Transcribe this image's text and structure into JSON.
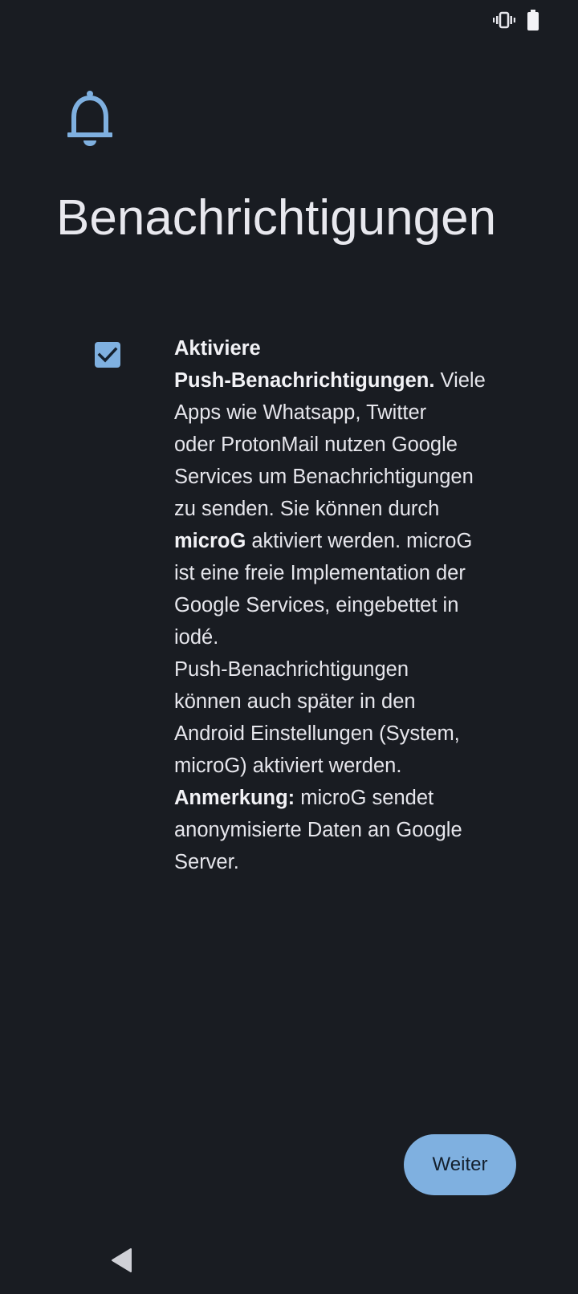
{
  "status_bar": {
    "icons": [
      "vibrate-icon",
      "battery-icon"
    ]
  },
  "header": {
    "icon": "bell-icon",
    "title": "Benachrichtigungen"
  },
  "option": {
    "checked": true,
    "lines": [
      {
        "bold": "Aktiviere",
        "text": ""
      },
      {
        "bold": "Push-Benachrichtigungen.",
        "text": " Viele"
      },
      {
        "bold": "",
        "text": "Apps wie Whatsapp, Twitter"
      },
      {
        "bold": "",
        "text": "oder ProtonMail nutzen Google"
      },
      {
        "bold": "",
        "text": "Services um Benachrichtigungen"
      },
      {
        "bold": "",
        "text": "zu senden. Sie können durch"
      },
      {
        "bold": "microG",
        "text": " aktiviert werden. microG"
      },
      {
        "bold": "",
        "text": "ist eine freie Implementation der"
      },
      {
        "bold": "",
        "text": "Google Services, eingebettet in"
      },
      {
        "bold": "",
        "text": "iodé."
      },
      {
        "bold": "",
        "text": "Push-Benachrichtigungen"
      },
      {
        "bold": "",
        "text": "können auch später in den"
      },
      {
        "bold": "",
        "text": "Android Einstellungen (System,"
      },
      {
        "bold": "",
        "text": "microG) aktiviert werden."
      },
      {
        "bold": "Anmerkung:",
        "text": " microG sendet"
      },
      {
        "bold": "",
        "text": "anonymisierte Daten an Google"
      },
      {
        "bold": "",
        "text": "Server."
      }
    ]
  },
  "footer": {
    "next_label": "Weiter"
  },
  "nav_bar": {
    "back_icon": "back-triangle-icon"
  },
  "colors": {
    "background": "#191c22",
    "accent": "#7fb0e0",
    "text": "#e6e6ec"
  }
}
